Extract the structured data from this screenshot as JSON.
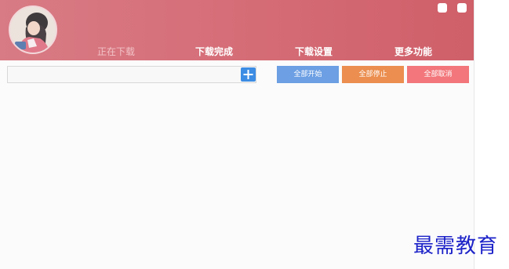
{
  "header": {
    "tabs": [
      {
        "label": "正在下载",
        "active": true
      },
      {
        "label": "下载完成",
        "active": false
      },
      {
        "label": "下载设置",
        "active": false
      },
      {
        "label": "更多功能",
        "active": false
      }
    ]
  },
  "toolbar": {
    "search_value": "",
    "add_icon": "plus-icon",
    "buttons": [
      {
        "label": "全部开始",
        "color": "#6c9fe3"
      },
      {
        "label": "全部停止",
        "color": "#eb8e4f"
      },
      {
        "label": "全部取消",
        "color": "#f2767b"
      }
    ]
  },
  "colors": {
    "header_accent": "#d6707a",
    "add_button": "#3d8de4"
  },
  "watermark": "最需教育"
}
